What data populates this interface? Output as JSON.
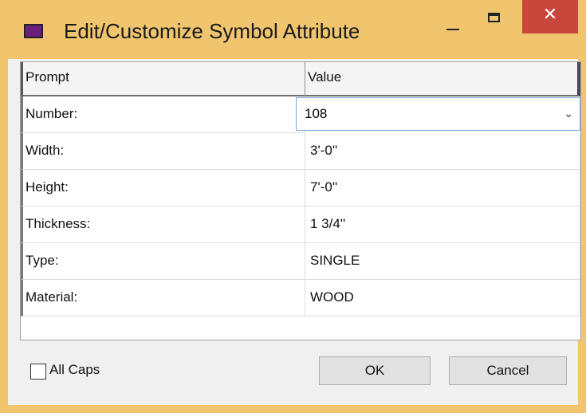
{
  "window": {
    "title": "Edit/Customize Symbol Attribute",
    "icons": {
      "app": "app-icon",
      "minimize": "minimize-icon",
      "maximize": "maximize-icon",
      "close": "close-icon"
    },
    "colors": {
      "title_bar": "#f0c56e",
      "close": "#c9463d"
    }
  },
  "grid": {
    "columns": [
      "Prompt",
      "Value"
    ],
    "rows": [
      {
        "prompt": "Number:",
        "value": "108"
      },
      {
        "prompt": "Width:",
        "value": "3'-0''"
      },
      {
        "prompt": "Height:",
        "value": "7'-0''"
      },
      {
        "prompt": "Thickness:",
        "value": "1 3/4''"
      },
      {
        "prompt": "Type:",
        "value": "SINGLE"
      },
      {
        "prompt": "Material:",
        "value": "WOOD"
      }
    ]
  },
  "footer": {
    "all_caps_label": "All Caps",
    "all_caps_checked": false,
    "ok_label": "OK",
    "cancel_label": "Cancel"
  }
}
